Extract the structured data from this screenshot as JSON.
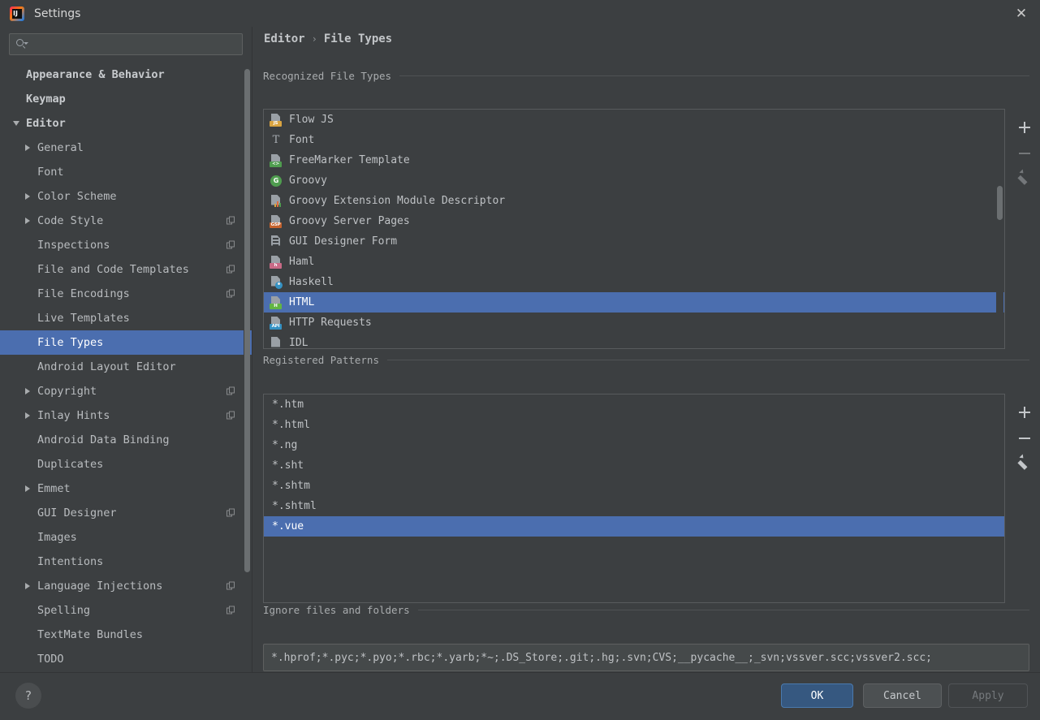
{
  "window": {
    "title": "Settings",
    "logo_icon": "intellij-idea-logo",
    "logo_mark": "IJ",
    "close_icon": "close-icon",
    "close_glyph": "✕"
  },
  "search": {
    "value": "",
    "placeholder": "",
    "icon": "search-icon"
  },
  "sidebar": {
    "items": [
      {
        "label": "Appearance & Behavior",
        "indent": 0,
        "twisty": "none",
        "bold": true,
        "selected": false,
        "copy_badge": false
      },
      {
        "label": "Keymap",
        "indent": 0,
        "twisty": "none",
        "bold": true,
        "selected": false,
        "copy_badge": false
      },
      {
        "label": "Editor",
        "indent": 0,
        "twisty": "expanded",
        "bold": true,
        "selected": false,
        "copy_badge": false
      },
      {
        "label": "General",
        "indent": 1,
        "twisty": "collapsed",
        "bold": false,
        "selected": false,
        "copy_badge": false
      },
      {
        "label": "Font",
        "indent": 1,
        "twisty": "none",
        "bold": false,
        "selected": false,
        "copy_badge": false
      },
      {
        "label": "Color Scheme",
        "indent": 1,
        "twisty": "collapsed",
        "bold": false,
        "selected": false,
        "copy_badge": false
      },
      {
        "label": "Code Style",
        "indent": 1,
        "twisty": "collapsed",
        "bold": false,
        "selected": false,
        "copy_badge": true
      },
      {
        "label": "Inspections",
        "indent": 1,
        "twisty": "none",
        "bold": false,
        "selected": false,
        "copy_badge": true
      },
      {
        "label": "File and Code Templates",
        "indent": 1,
        "twisty": "none",
        "bold": false,
        "selected": false,
        "copy_badge": true
      },
      {
        "label": "File Encodings",
        "indent": 1,
        "twisty": "none",
        "bold": false,
        "selected": false,
        "copy_badge": true
      },
      {
        "label": "Live Templates",
        "indent": 1,
        "twisty": "none",
        "bold": false,
        "selected": false,
        "copy_badge": false
      },
      {
        "label": "File Types",
        "indent": 1,
        "twisty": "none",
        "bold": false,
        "selected": true,
        "copy_badge": false
      },
      {
        "label": "Android Layout Editor",
        "indent": 1,
        "twisty": "none",
        "bold": false,
        "selected": false,
        "copy_badge": false
      },
      {
        "label": "Copyright",
        "indent": 1,
        "twisty": "collapsed",
        "bold": false,
        "selected": false,
        "copy_badge": true
      },
      {
        "label": "Inlay Hints",
        "indent": 1,
        "twisty": "collapsed",
        "bold": false,
        "selected": false,
        "copy_badge": true
      },
      {
        "label": "Android Data Binding",
        "indent": 1,
        "twisty": "none",
        "bold": false,
        "selected": false,
        "copy_badge": false
      },
      {
        "label": "Duplicates",
        "indent": 1,
        "twisty": "none",
        "bold": false,
        "selected": false,
        "copy_badge": false
      },
      {
        "label": "Emmet",
        "indent": 1,
        "twisty": "collapsed",
        "bold": false,
        "selected": false,
        "copy_badge": false
      },
      {
        "label": "GUI Designer",
        "indent": 1,
        "twisty": "none",
        "bold": false,
        "selected": false,
        "copy_badge": true
      },
      {
        "label": "Images",
        "indent": 1,
        "twisty": "none",
        "bold": false,
        "selected": false,
        "copy_badge": false
      },
      {
        "label": "Intentions",
        "indent": 1,
        "twisty": "none",
        "bold": false,
        "selected": false,
        "copy_badge": false
      },
      {
        "label": "Language Injections",
        "indent": 1,
        "twisty": "collapsed",
        "bold": false,
        "selected": false,
        "copy_badge": true
      },
      {
        "label": "Spelling",
        "indent": 1,
        "twisty": "none",
        "bold": false,
        "selected": false,
        "copy_badge": true
      },
      {
        "label": "TextMate Bundles",
        "indent": 1,
        "twisty": "none",
        "bold": false,
        "selected": false,
        "copy_badge": false
      },
      {
        "label": "TODO",
        "indent": 1,
        "twisty": "none",
        "bold": false,
        "selected": false,
        "copy_badge": false
      }
    ]
  },
  "breadcrumb": {
    "parent": "Editor",
    "separator": "›",
    "current": "File Types"
  },
  "recognized": {
    "group_label": "Recognized File Types",
    "items": [
      {
        "label": "Flow JS",
        "icon": "file-js-icon",
        "badge": "JS",
        "badge_color": "#d9a441",
        "style": "page-badge"
      },
      {
        "label": "Font",
        "icon": "font-icon",
        "badge": "",
        "badge_color": "",
        "style": "letter-T"
      },
      {
        "label": "FreeMarker Template",
        "icon": "file-freemarker-icon",
        "badge": "<>",
        "badge_color": "#4f9d4f",
        "style": "page-badge"
      },
      {
        "label": "Groovy",
        "icon": "groovy-icon",
        "badge": "G",
        "badge_color": "#4f9d4f",
        "style": "circle"
      },
      {
        "label": "Groovy Extension Module Descriptor",
        "icon": "properties-icon",
        "badge": "",
        "badge_color": "",
        "style": "page-bars"
      },
      {
        "label": "Groovy Server Pages",
        "icon": "file-gsp-icon",
        "badge": "GSP",
        "badge_color": "#c4622d",
        "style": "page-badge"
      },
      {
        "label": "GUI Designer Form",
        "icon": "gui-form-icon",
        "badge": "",
        "badge_color": "",
        "style": "form"
      },
      {
        "label": "Haml",
        "icon": "file-haml-icon",
        "badge": "h",
        "badge_color": "#c86a86",
        "style": "page-badge"
      },
      {
        "label": "Haskell",
        "icon": "haskell-icon",
        "badge": "",
        "badge_color": "",
        "style": "page-person"
      },
      {
        "label": "HTML",
        "icon": "file-html-icon",
        "badge": "H",
        "badge_color": "#62b543",
        "style": "page-badge"
      },
      {
        "label": "HTTP Requests",
        "icon": "file-api-icon",
        "badge": "API",
        "badge_color": "#3592c4",
        "style": "page-badge"
      },
      {
        "label": "IDL",
        "icon": "file-idl-icon",
        "badge": "",
        "badge_color": "",
        "style": "page-plain"
      }
    ],
    "selected_index": 9,
    "toolbar": [
      {
        "name": "add-file-type-button",
        "icon": "plus-icon",
        "enabled": true
      },
      {
        "name": "remove-file-type-button",
        "icon": "minus-icon",
        "enabled": false
      },
      {
        "name": "edit-file-type-button",
        "icon": "pencil-icon",
        "enabled": false
      }
    ]
  },
  "patterns": {
    "group_label": "Registered Patterns",
    "items": [
      "*.htm",
      "*.html",
      "*.ng",
      "*.sht",
      "*.shtm",
      "*.shtml",
      "*.vue"
    ],
    "selected_index": 6,
    "toolbar": [
      {
        "name": "add-pattern-button",
        "icon": "plus-icon",
        "enabled": true
      },
      {
        "name": "remove-pattern-button",
        "icon": "minus-icon",
        "enabled": true
      },
      {
        "name": "edit-pattern-button",
        "icon": "pencil-icon",
        "enabled": true
      }
    ]
  },
  "ignore": {
    "group_label": "Ignore files and folders",
    "value": "*.hprof;*.pyc;*.pyo;*.rbc;*.yarb;*~;.DS_Store;.git;.hg;.svn;CVS;__pycache__;_svn;vssver.scc;vssver2.scc;"
  },
  "footer": {
    "help_icon": "help-icon",
    "help_glyph": "?",
    "ok_label": "OK",
    "cancel_label": "Cancel",
    "apply_label": "Apply",
    "apply_enabled": false
  },
  "colors": {
    "selection": "#4b6eaf",
    "ok_button": "#365880",
    "background": "#3c3f41",
    "field_background": "#45494a"
  }
}
